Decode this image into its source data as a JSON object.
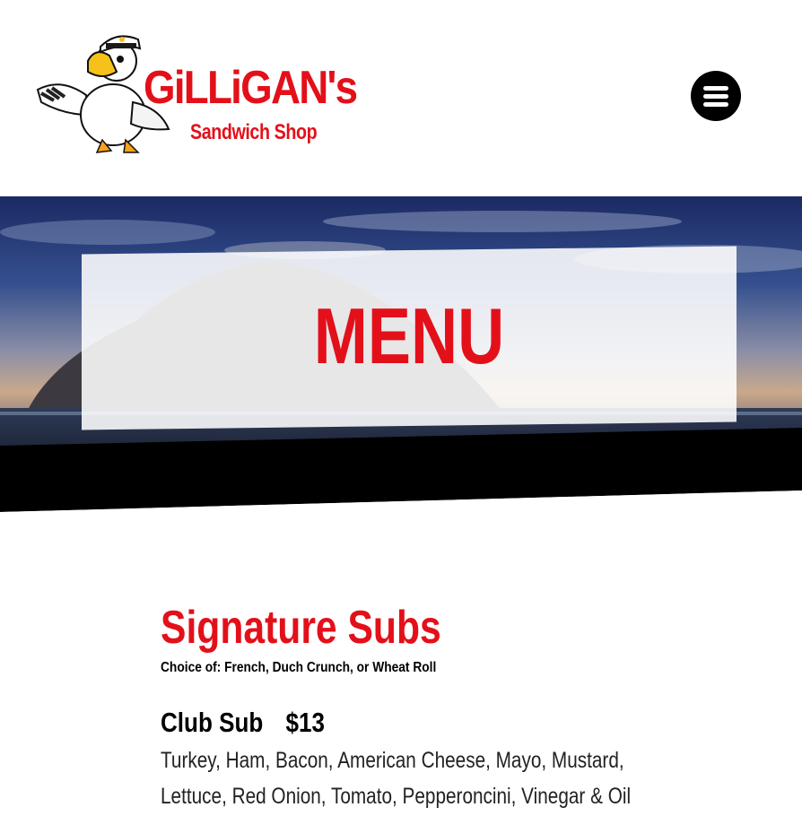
{
  "header": {
    "brand_name": "GiLLiGAN's",
    "brand_sub": "Sandwich Shop",
    "menu_button_icon": "hamburger-menu-icon"
  },
  "hero": {
    "title": "MENU"
  },
  "section": {
    "title": "Signature Subs",
    "note": "Choice of: French, Duch Crunch, or Wheat Roll",
    "items": [
      {
        "name": "Club Sub",
        "price": "$13",
        "description": "Turkey, Ham, Bacon, American Cheese, Mayo, Mustard, Lettuce, Red Onion, Tomato, Pepperoncini, Vinegar & Oil w/"
      }
    ]
  },
  "colors": {
    "accent_red": "#e3101a",
    "black": "#000000",
    "white": "#ffffff"
  }
}
